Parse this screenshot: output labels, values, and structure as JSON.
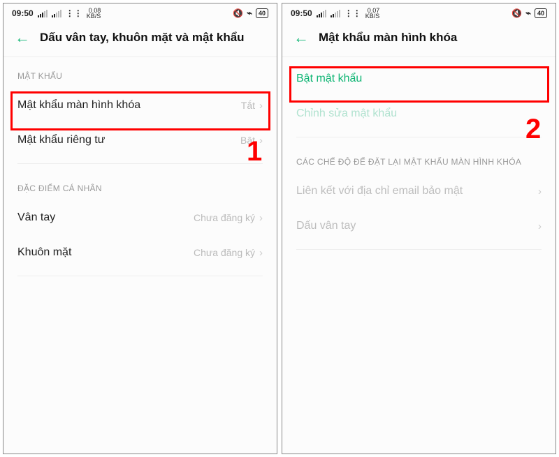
{
  "left": {
    "status": {
      "time": "09:50",
      "kbs": "0.08",
      "kbs_unit": "KB/S",
      "battery": "40"
    },
    "title": "Dấu vân tay, khuôn mặt và mật khẩu",
    "sections": [
      {
        "label": "MẬT KHẨU",
        "rows": [
          {
            "label": "Mật khẩu màn hình khóa",
            "value": "Tắt"
          },
          {
            "label": "Mật khẩu riêng tư",
            "value": "Bật"
          }
        ]
      },
      {
        "label": "ĐẶC ĐIỂM CÁ NHÂN",
        "rows": [
          {
            "label": "Vân tay",
            "value": "Chưa đăng ký"
          },
          {
            "label": "Khuôn mặt",
            "value": "Chưa đăng ký"
          }
        ]
      }
    ],
    "annot": "1"
  },
  "right": {
    "status": {
      "time": "09:50",
      "kbs": "0.07",
      "kbs_unit": "KB/S",
      "battery": "40"
    },
    "title": "Mật khẩu màn hình khóa",
    "rows_top": [
      {
        "label": "Bật mật khẩu"
      },
      {
        "label": "Chỉnh sửa mật khẩu"
      }
    ],
    "section_label": "CÁC CHẾ ĐỘ ĐỂ ĐẶT LẠI MẬT KHẨU MÀN HÌNH KHÓA",
    "rows_bottom": [
      {
        "label": "Liên kết với địa chỉ email bảo mật"
      },
      {
        "label": "Dấu vân tay"
      }
    ],
    "annot": "2"
  }
}
